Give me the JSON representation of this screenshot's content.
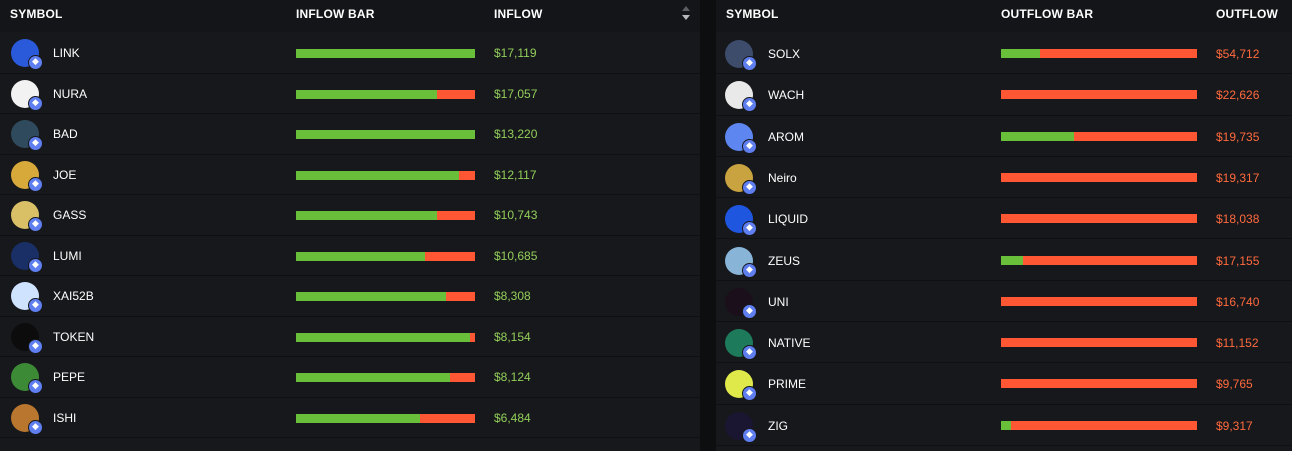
{
  "colors": {
    "inflow_text": "#93cf5a",
    "outflow_text": "#ff6a3d",
    "bar_green": "#6abf3a",
    "bar_red": "#ff5733",
    "background": "#17181c"
  },
  "inflow_table": {
    "headers": {
      "symbol": "SYMBOL",
      "bar": "INFLOW BAR",
      "value": "INFLOW"
    },
    "rows": [
      {
        "symbol": "LINK",
        "value": "$17,119",
        "green_fraction": 1.0,
        "icon": "link-chain-hexagon-icon",
        "logo_bg": "#2a5ada"
      },
      {
        "symbol": "NURA",
        "value": "$17,057",
        "green_fraction": 0.79,
        "icon": "nura-logo-icon",
        "logo_bg": "#f2f2f2"
      },
      {
        "symbol": "BAD",
        "value": "$13,220",
        "green_fraction": 1.0,
        "icon": "bad-logo-icon",
        "logo_bg": "#2f4a5c"
      },
      {
        "symbol": "JOE",
        "value": "$12,117",
        "green_fraction": 0.91,
        "icon": "joe-face-icon",
        "logo_bg": "#d7a93a"
      },
      {
        "symbol": "GASS",
        "value": "$10,743",
        "green_fraction": 0.79,
        "icon": "gass-character-icon",
        "logo_bg": "#d9c066"
      },
      {
        "symbol": "LUMI",
        "value": "$10,685",
        "green_fraction": 0.72,
        "icon": "lumi-character-icon",
        "logo_bg": "#1a2f66"
      },
      {
        "symbol": "XAI52B",
        "value": "$8,308",
        "green_fraction": 0.84,
        "icon": "xai52b-logo-icon",
        "logo_bg": "#cfe3ff"
      },
      {
        "symbol": "TOKEN",
        "value": "$8,154",
        "green_fraction": 0.97,
        "icon": "token-logo-icon",
        "logo_bg": "#0c0c0c"
      },
      {
        "symbol": "PEPE",
        "value": "$8,124",
        "green_fraction": 0.86,
        "icon": "pepe-frog-icon",
        "logo_bg": "#3c8a35"
      },
      {
        "symbol": "ISHI",
        "value": "$6,484",
        "green_fraction": 0.69,
        "icon": "ishi-character-icon",
        "logo_bg": "#b8762e"
      }
    ]
  },
  "outflow_table": {
    "headers": {
      "symbol": "SYMBOL",
      "bar": "OUTFLOW BAR",
      "value": "OUTFLOW"
    },
    "rows": [
      {
        "symbol": "SOLX",
        "value": "$54,712",
        "green_fraction": 0.2,
        "icon": "solx-ufo-icon",
        "logo_bg": "#3c4c6a"
      },
      {
        "symbol": "WACH",
        "value": "$22,626",
        "green_fraction": 0.0,
        "icon": "wach-character-icon",
        "logo_bg": "#e9e9e9"
      },
      {
        "symbol": "AROM",
        "value": "$19,735",
        "green_fraction": 0.37,
        "icon": "ethereum-diamond-icon",
        "logo_bg": "#5e86f0"
      },
      {
        "symbol": "Neiro",
        "value": "$19,317",
        "green_fraction": 0.0,
        "icon": "neiro-dog-icon",
        "logo_bg": "#c9a340"
      },
      {
        "symbol": "LIQUID",
        "value": "$18,038",
        "green_fraction": 0.0,
        "icon": "liquid-logo-icon",
        "logo_bg": "#1f56e0"
      },
      {
        "symbol": "ZEUS",
        "value": "$17,155",
        "green_fraction": 0.11,
        "icon": "zeus-dog-icon",
        "logo_bg": "#88b4d8"
      },
      {
        "symbol": "UNI",
        "value": "$16,740",
        "green_fraction": 0.0,
        "icon": "uniswap-unicorn-icon",
        "logo_bg": "#1a0f1a"
      },
      {
        "symbol": "NATIVE",
        "value": "$11,152",
        "green_fraction": 0.0,
        "icon": "native-logo-icon",
        "logo_bg": "#1d7a5a"
      },
      {
        "symbol": "PRIME",
        "value": "$9,765",
        "green_fraction": 0.0,
        "icon": "prime-stripes-icon",
        "logo_bg": "#dfe94a"
      },
      {
        "symbol": "ZIG",
        "value": "$9,317",
        "green_fraction": 0.05,
        "icon": "zig-bars-icon",
        "logo_bg": "#1a1530"
      }
    ]
  }
}
